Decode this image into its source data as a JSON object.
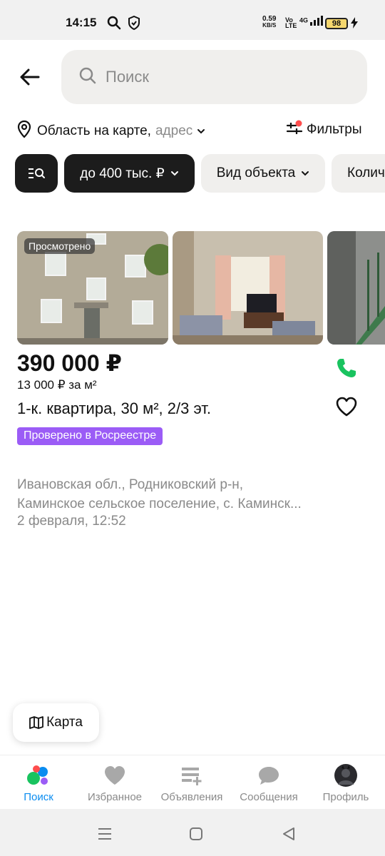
{
  "status_bar": {
    "time": "14:15",
    "net_speed_value": "0.59",
    "net_speed_unit": "KB/S",
    "volte_top": "Vo",
    "volte_bottom": "LTE",
    "network": "4G",
    "battery": "98"
  },
  "search": {
    "placeholder": "Поиск"
  },
  "location": {
    "label": "Область на карте,",
    "sub": "адрес"
  },
  "filters": {
    "label": "Фильтры",
    "dot_color": "#ff4d4d"
  },
  "chips": [
    {
      "label": ""
    },
    {
      "label": "до 400 тыс. ₽"
    },
    {
      "label": "Вид объекта"
    },
    {
      "label": "Колич"
    }
  ],
  "listing": {
    "seen_badge": "Просмотрено",
    "price": "390 000 ₽",
    "price_per_m2": "13 000 ₽ за м²",
    "title": "1-к. квартира, 30 м², 2/3 эт.",
    "rosreestr_badge": "Проверено в Росреестре",
    "address_line1": "Ивановская обл., Родниковский р-н,",
    "address_line2": "Каминское сельское поселение, с. Каминск...",
    "date": "2 февраля, 12:52"
  },
  "map_button": {
    "label": "Карта"
  },
  "bottom_nav": {
    "items": [
      {
        "label": "Поиск",
        "icon": "search-dots-icon",
        "active": true
      },
      {
        "label": "Избранное",
        "icon": "heart-icon"
      },
      {
        "label": "Объявления",
        "icon": "ads-list-icon"
      },
      {
        "label": "Сообщения",
        "icon": "chat-icon"
      },
      {
        "label": "Профиль",
        "icon": "avatar"
      }
    ]
  },
  "colors": {
    "accent_blue": "#0a8cf0",
    "rosreestr_purple": "#9b5cf6",
    "call_green": "#19c35f"
  }
}
